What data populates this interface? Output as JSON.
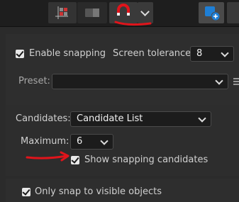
{
  "snapping": {
    "enable_label": "Enable snapping",
    "enable_checked": true,
    "tolerance_label": "Screen tolerance:",
    "tolerance_value": "8"
  },
  "preset": {
    "label": "Preset:",
    "value": ""
  },
  "candidates": {
    "label": "Candidates:",
    "value": "Candidate List",
    "maximum_label": "Maximum:",
    "maximum_value": "6",
    "show_label": "Show snapping candidates",
    "show_checked": true
  },
  "visible_only": {
    "label": "Only snap to visible objects",
    "checked": true
  },
  "colors": {
    "annotation_red": "#e0141b",
    "accent_blue": "#1e7fd6",
    "panel_bg": "#2b2b2b"
  },
  "icons": [
    "grid-icon",
    "toggle-icon",
    "magnet-icon",
    "chevron-down-icon",
    "add-layer-icon"
  ]
}
